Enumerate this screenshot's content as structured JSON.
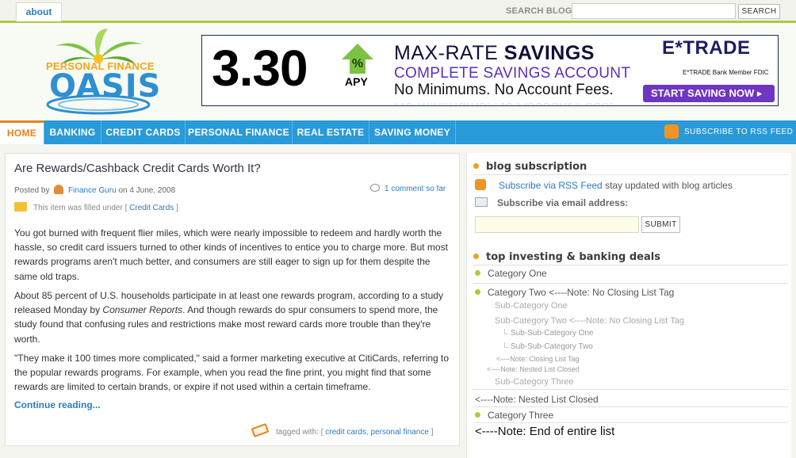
{
  "topbar": {
    "about_tab": "about",
    "search_label": "SEARCH BLOG",
    "search_value": "",
    "search_button": "SEARCH"
  },
  "logo": {
    "line1": "PERSONAL FINANCE",
    "line2": "OASIS"
  },
  "banner": {
    "rate": "3.30",
    "percent_sign": "%",
    "apy": "APY",
    "headline_prefix": "MAX-RATE ",
    "headline_bold": "SAVINGS",
    "subhead": "COMPLETE SAVINGS ACCOUNT",
    "tagline": "No Minimums. No Account Fees.",
    "brand": "E*TRADE",
    "fdic": "E*TRADE Bank Member FDIC",
    "cta": "START SAVING NOW ▸"
  },
  "nav": {
    "items": [
      "HOME",
      "BANKING",
      "CREDIT CARDS",
      "PERSONAL FINANCE",
      "REAL ESTATE",
      "SAVING MONEY"
    ],
    "rss_label": "SUBSCRIBE TO RSS FEED"
  },
  "post": {
    "title": "Are Rewards/Cashback Credit Cards Worth It?",
    "posted_by": "Posted by",
    "author": "Finance Guru",
    "date_text": "on 4 June, 2008",
    "comments": "1 comment so far",
    "filed_text": "This item was filled under [",
    "filed_category": "Credit Cards",
    "filed_close": "]",
    "paragraphs": [
      "You got burned with frequent flier miles, which were nearly impossible to redeem and hardly worth the hassle, so credit card issuers turned to other kinds of incentives to entice you to charge more. But most rewards programs aren't much better, and consumers are still eager to sign up for them despite the same old traps.",
      "About 85 percent of U.S. households participate in at least one rewards program, according to a study released Monday by ",
      "Consumer Reports",
      ". And though rewards do spur consumers to spend more, the study found that confusing rules and restrictions make most reward cards more trouble than they're worth.",
      "\"They make it 100 times more complicated,\" said a former marketing executive at CitiCards, referring to the popular rewards programs. For example, when you read the fine print, you might find that some rewards are limited to certain brands, or expire if not used within a certain timeframe."
    ],
    "continue": "Continue reading...",
    "tagged_label": "tagged with: [",
    "tag1": "credit cards",
    "tag_sep": ",",
    "tag2": "personal finance",
    "tag_close": "]"
  },
  "sidebar": {
    "subscription_heading": "blog subscription",
    "rss_link": "Subscribe via RSS Feed",
    "rss_suffix": " stay updated with blog articles",
    "email_label": "Subscribe via email address:",
    "email_value": "",
    "submit": "SUBMIT",
    "deals_heading": "top investing & banking deals",
    "list": {
      "cat1": "Category One",
      "cat2": "Category Two <----Note: No Closing List Tag",
      "sub1": "Sub-Category One",
      "sub2": "Sub-Category Two <----Note: No Closing List Tag",
      "subsub1": "Sub-Sub-Category One",
      "subsub2": "Sub-Sub-Category Two",
      "note_closing": "<----Note: Closing List Tag",
      "note_nested_closed_small": "<----Note: Nested List Closed",
      "sub3": "Sub-Category Three",
      "note_nested_closed": "<----Note: Nested List Closed",
      "cat3": "Category Three",
      "note_end": "<----Note: End of entire list"
    }
  }
}
